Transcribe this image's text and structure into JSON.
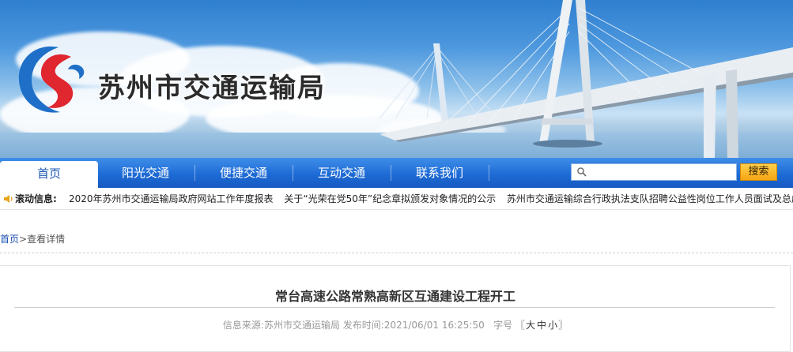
{
  "header": {
    "site_title": "苏州市交通运输局"
  },
  "nav": {
    "items": [
      {
        "label": "首页",
        "active": true
      },
      {
        "label": "阳光交通",
        "active": false
      },
      {
        "label": "便捷交通",
        "active": false
      },
      {
        "label": "互动交通",
        "active": false
      },
      {
        "label": "联系我们",
        "active": false
      }
    ],
    "search": {
      "placeholder": "",
      "button_label": "搜索"
    }
  },
  "ticker": {
    "label": "滚动信息:",
    "items": [
      "2020年苏州市交通运输局政府网站工作年度报表",
      "关于“光荣在党50年”纪念章拟颁发对象情况的公示",
      "苏州市交通运输综合行政执法支队招聘公益性岗位工作人员面试及总成绩公示"
    ]
  },
  "breadcrumb": {
    "home": "首页",
    "separator": ">",
    "current": "查看详情"
  },
  "article": {
    "title": "常台高速公路常熟高新区互通建设工程开工",
    "source_label": "信息来源:",
    "source": "苏州市交通运输局",
    "date_label": "发布时间:",
    "date": "2021/06/01 16:25:50",
    "font_size_label": "字号",
    "bracket_open": "〖",
    "size_large": "大",
    "size_medium": "中",
    "size_small": "小",
    "bracket_close": "〗"
  },
  "colors": {
    "nav_blue": "#1e6bd6",
    "active_tab_text": "#1a55b0",
    "search_button": "#f5a514",
    "link_blue": "#1a4fb3"
  },
  "icons": {
    "logo": "suzhou-transport-logo",
    "search": "magnifier-icon",
    "ticker": "speaker-icon"
  }
}
